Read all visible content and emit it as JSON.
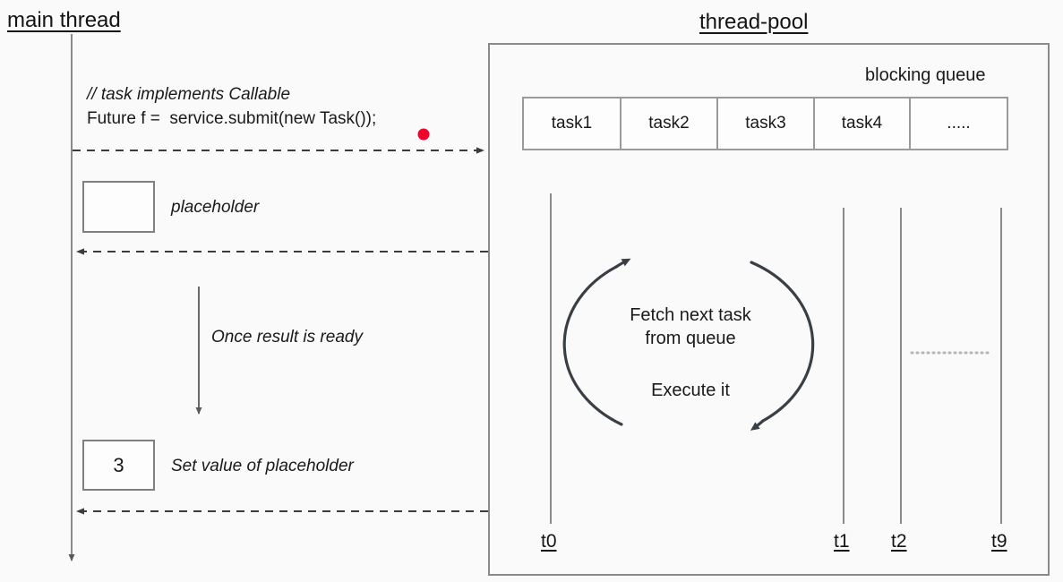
{
  "diagram": {
    "title_left": "main thread",
    "title_right": "thread-pool",
    "code": {
      "comment": "// task implements Callable",
      "statement": "Future f =  service.submit(new Task());"
    },
    "notes": {
      "placeholder": "placeholder",
      "once_ready": "Once result is ready",
      "set_value": "Set value of placeholder"
    },
    "boxes": {
      "empty_placeholder_value": "",
      "result_value": "3"
    },
    "queue": {
      "label": "blocking queue",
      "cells": [
        "task1",
        "task2",
        "task3",
        "task4",
        "....."
      ]
    },
    "worker_cycle": {
      "line1": "Fetch next task",
      "line2": "from queue",
      "line3": "Execute it"
    },
    "threads": [
      {
        "id": "t0",
        "label": "t0"
      },
      {
        "id": "t1",
        "label": "t1"
      },
      {
        "id": "t2",
        "label": "t2"
      },
      {
        "id": "t9",
        "label": "t9"
      }
    ],
    "colors": {
      "marker_red": "#f4022c",
      "line_gray": "#8a8a8a",
      "text_dark": "#1a1a1a",
      "canvas_bg": "#fafafa"
    }
  }
}
